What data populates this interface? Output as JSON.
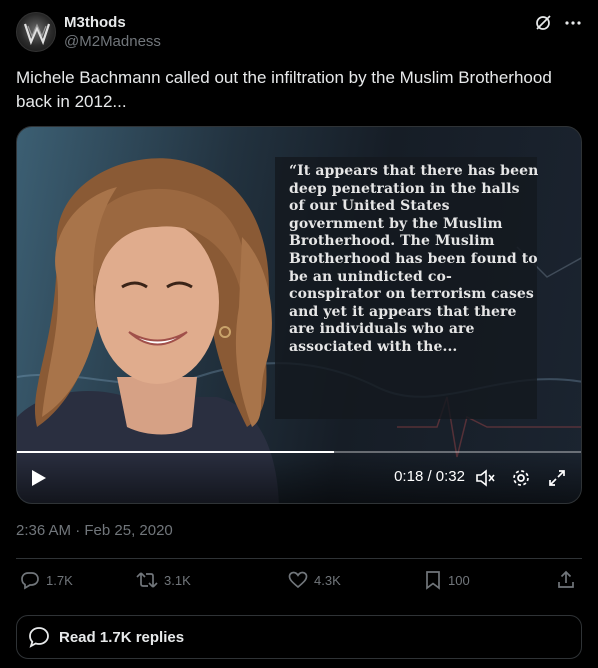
{
  "tweet": {
    "author": {
      "display_name": "M3thods",
      "handle": "@M2Madness",
      "avatar_icon": "m3thods-logo-avatar"
    },
    "header_icons": [
      "grok-icon",
      "more-options-icon"
    ],
    "text": "Michele Bachmann called out the infiltration by the Muslim Brotherhood back in 2012...",
    "video": {
      "quote": "“It appears that there has been deep penetration in the halls of our United States government by the Muslim Brotherhood. The Muslim Brotherhood has been found to be an unindicted co-conspirator on terrorism cases and yet it appears that there are individuals who are associated with the...",
      "time": "0:18 / 0:32",
      "progress": 0.5625,
      "controls": [
        "play-icon",
        "mute-icon",
        "settings-icon",
        "fullscreen-icon"
      ]
    },
    "timestamp": "2:36 AM · Feb 25, 2020",
    "actions": {
      "replies": "1.7K",
      "reposts": "3.1K",
      "likes": "4.3K",
      "bookmarks": "100"
    },
    "read_replies": "Read 1.7K replies"
  },
  "colors": {
    "background": "#000000",
    "text_primary": "#e7e9ea",
    "text_secondary": "#71767b",
    "border": "#2f3336"
  }
}
